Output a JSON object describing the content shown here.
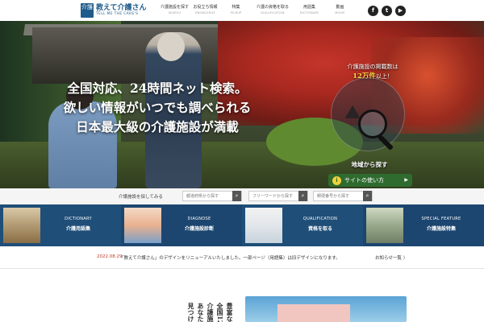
{
  "header": {
    "logo_mark": "介護",
    "logo_title": "教えて介護さん",
    "logo_sub": "TELL ME THE CARE'S",
    "nav": [
      {
        "jp": "介護施設を探す",
        "en": "SEARCH"
      },
      {
        "jp": "お役立ち情報",
        "en": "KNOWLEDGE"
      },
      {
        "jp": "特集",
        "en": "PICKUP"
      },
      {
        "jp": "介護の資格を取る",
        "en": "QUALIFICATION"
      },
      {
        "jp": "用語集",
        "en": "DICTIONARY"
      },
      {
        "jp": "動画",
        "en": "MOVIE"
      }
    ],
    "social": [
      {
        "icon": "facebook-icon",
        "glyph": "f"
      },
      {
        "icon": "twitter-icon",
        "glyph": "t"
      },
      {
        "icon": "youtube-icon",
        "glyph": "▶"
      }
    ]
  },
  "hero": {
    "lines": [
      "全国対応、24時間ネット検索。",
      "欲しい情報がいつでも調べられる",
      "日本最大級の介護施設が満載"
    ],
    "badge_line_prefix": "介護施設の掲載数は",
    "badge_highlight": "12万件",
    "badge_line_suffix": "以上！",
    "badge_search": "地域から探す",
    "usage_button": "サイトの使い方",
    "slides": 5,
    "active_slide": 0
  },
  "search": {
    "label": "介護施設を探してみる",
    "fields": [
      {
        "placeholder": "都道府県から探す"
      },
      {
        "placeholder": "フリーワードから探す"
      },
      {
        "placeholder": "郵便番号から探す"
      }
    ]
  },
  "categories": [
    {
      "en": "DICTIONARY",
      "jp": "介護用語集"
    },
    {
      "en": "DIAGNOSE",
      "jp": "介護施設診断"
    },
    {
      "en": "QUALIFICATION",
      "jp": "資格を取る"
    },
    {
      "en": "SPECIAL FEATURE",
      "jp": "介護施設特集"
    }
  ],
  "news": {
    "date": "2022.08.29",
    "text": "「教えて介護さん」のデザインをリニューアルいたしました。一部ページ（用語集）は旧デザインになります。",
    "more": "お知らせ一覧 〉"
  },
  "bottom": {
    "columns": [
      "見つけ",
      "あなた",
      "介護施",
      "全国12",
      "豊富な"
    ]
  },
  "colors": {
    "brand": "#1f5c8c",
    "category_bg": "#1f4e78",
    "news_date": "#c0392b",
    "usage_button": "#2f6b2f",
    "highlight": "#ffd84a"
  }
}
